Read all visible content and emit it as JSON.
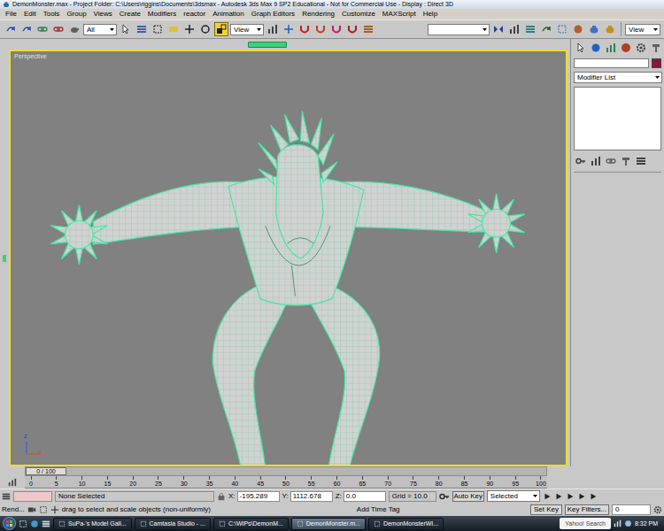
{
  "window": {
    "title": "DemonMonster.max - Project Folder: C:\\Users\\riggins\\Documents\\3dsmax - Autodesk 3ds Max 9 SP2 Educational - Not for Commercial Use - Display : Direct 3D"
  },
  "menu": [
    "File",
    "Edit",
    "Tools",
    "Group",
    "Views",
    "Create",
    "Modifiers",
    "reactor",
    "Animation",
    "Graph Editors",
    "Rendering",
    "Customize",
    "MAXScript",
    "Help"
  ],
  "toolbar": {
    "selection_filter": "All",
    "reference_coord": "View",
    "render_view": "View",
    "select_tools": [
      {
        "selected": false
      },
      {
        "selected": false
      },
      {
        "selected": false
      },
      {
        "selected": false
      },
      {
        "selected": false
      },
      {
        "selected": false
      },
      {
        "selected": true
      }
    ]
  },
  "viewport": {
    "label": "Perspective",
    "axes": [
      "z",
      "x"
    ]
  },
  "command_panel": {
    "modifier_list": "Modifier List"
  },
  "timeline": {
    "position": "0 / 100",
    "level": 0
  },
  "ruler": {
    "ticks": [
      "0",
      "5",
      "10",
      "15",
      "20",
      "25",
      "30",
      "35",
      "40",
      "45",
      "50",
      "55",
      "60",
      "65",
      "70",
      "75",
      "80",
      "85",
      "90",
      "95",
      "100"
    ]
  },
  "status": {
    "selection": "None Selected",
    "prompt": "drag to select and scale objects (non-uniformly)",
    "render_label": "Rend...",
    "coordinates": [
      {
        "label": "X:",
        "value": "-195.289"
      },
      {
        "label": "Y:",
        "value": "1112.678"
      },
      {
        "label": "Z:",
        "value": "0.0"
      }
    ],
    "grid": "Grid = 10.0",
    "auto_key": "Auto Key",
    "set_key": "Set Key",
    "key_mode": "Selected",
    "key_filters": "Key Filters...",
    "add_time_tag": "Add Time Tag",
    "frame": "0"
  },
  "taskbar": {
    "items": [
      {
        "label": "SuPa-'s Model Gall...",
        "selected": false
      },
      {
        "label": "Camtasia Studio - ...",
        "selected": false
      },
      {
        "label": "C:\\WIPs\\DemonM...",
        "selected": false
      },
      {
        "label": "DemonMonster.m...",
        "selected": true
      },
      {
        "label": "DemonMonsterWI...",
        "selected": false
      }
    ],
    "search": "Yahoo! Search",
    "clock": "8:32 PM"
  }
}
